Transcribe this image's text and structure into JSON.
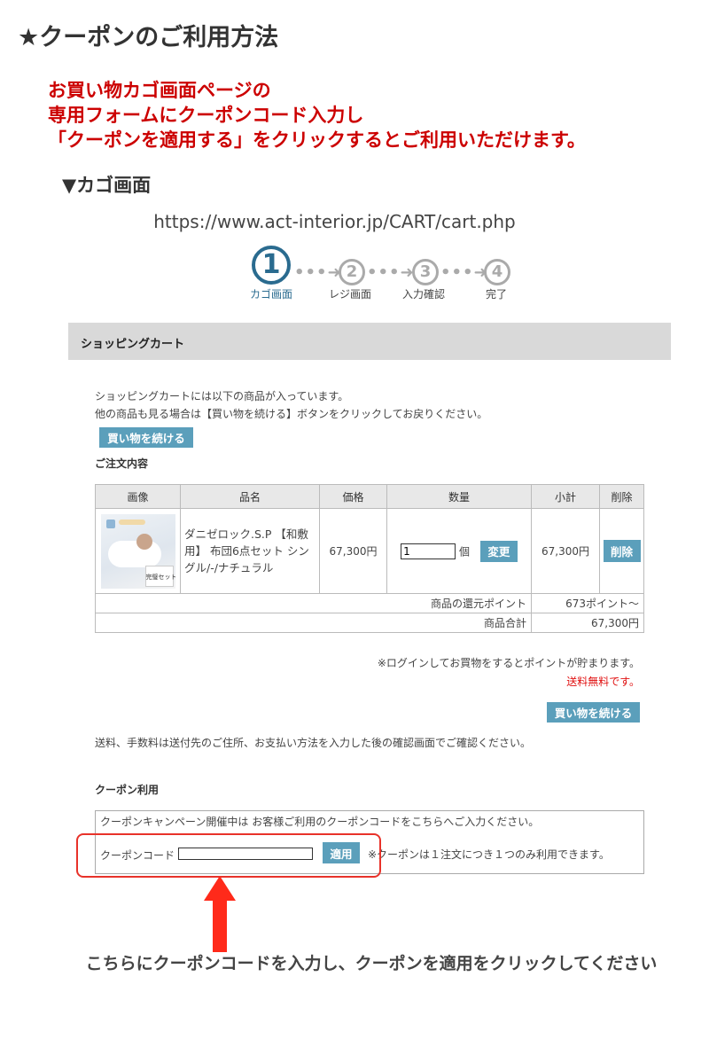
{
  "title": "★クーポンのご利用方法",
  "instructions": [
    "お買い物カゴ画面ページの",
    "専用フォームにクーポンコード入力し",
    "「クーポンを適用する」をクリックするとご利用いただけます。"
  ],
  "section_title": "▼カゴ画面",
  "url": "https://www.act-interior.jp/CART/cart.php",
  "steps": [
    {
      "number": "1",
      "label": "カゴ画面"
    },
    {
      "number": "2",
      "label": "レジ画面"
    },
    {
      "number": "3",
      "label": "入力確認"
    },
    {
      "number": "4",
      "label": "完了"
    }
  ],
  "cart": {
    "header": "ショッピングカート",
    "intro1": "ショッピングカートには以下の商品が入っています。",
    "intro2": "他の商品も見る場合は【買い物を続ける】ボタンをクリックしてお戻りください。",
    "continue_button": "買い物を続ける",
    "order_heading": "ご注文内容",
    "columns": [
      "画像",
      "品名",
      "価格",
      "数量",
      "小計",
      "削除"
    ],
    "item": {
      "image_caption": "完璧セット",
      "name": "ダニゼロック.S.P 【和敷用】 布団6点セット シングル/-/ナチュラル",
      "price": "67,300円",
      "quantity": "1",
      "quantity_unit": "個",
      "change_button": "変更",
      "subtotal": "67,300円",
      "delete_button": "削除"
    },
    "points_label": "商品の還元ポイント",
    "points_value": "673ポイント〜",
    "total_label": "商品合計",
    "total_value": "67,300円",
    "login_note": "※ログインしてお買物をするとポイントが貯まります。",
    "free_shipping": "送料無料です。",
    "continue_button2": "買い物を続ける",
    "shipping_note": "送料、手数料は送付先のご住所、お支払い方法を入力した後の確認画面でご確認ください。"
  },
  "coupon": {
    "heading": "クーポン利用",
    "campaign_text": "クーポンキャンペーン開催中は お客様ご利用のクーポンコードをこちらへご入力ください。",
    "code_label": "クーポンコード",
    "code_value": "",
    "apply_button": "適用",
    "note": "※クーポンは１注文につき１つのみ利用できます。"
  },
  "footer_instruction": "こちらにクーポンコードを入力し、クーポンを適用をクリックしてください",
  "colors": {
    "accent_red": "#cc0000",
    "button_blue": "#5b9fbb",
    "step_active": "#2a6b8f",
    "step_inactive": "#aaaaaa",
    "arrow_red": "#ff2a1a"
  }
}
